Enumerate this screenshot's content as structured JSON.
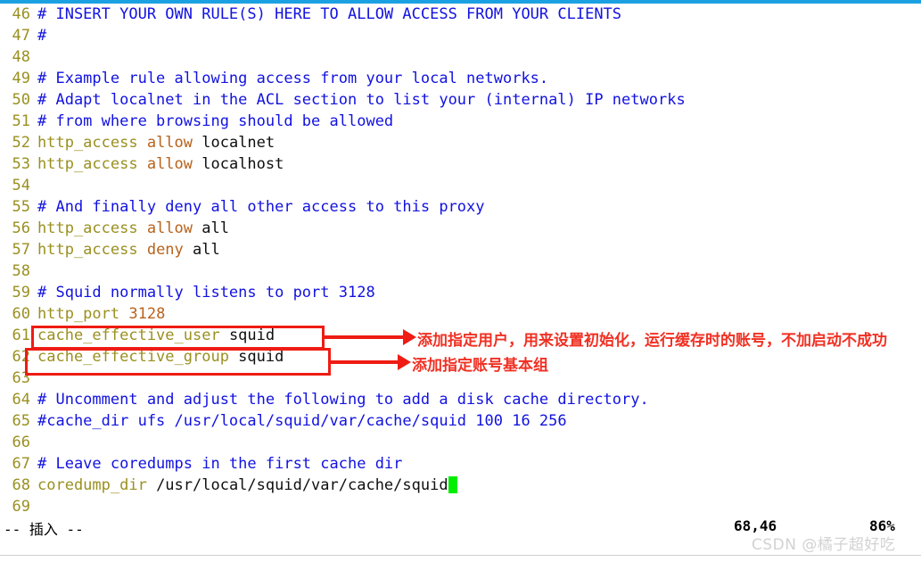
{
  "editor": {
    "app": "vim",
    "status": {
      "mode_label": "-- 插入 --",
      "position": "68,46",
      "percent": "86%"
    },
    "watermark": "CSDN @橘子超好吃",
    "lines": [
      {
        "num": "46",
        "tokens": [
          {
            "t": "# INSERT YOUR OWN RULE(S) HERE TO ALLOW ACCESS FROM YOUR CLIENTS",
            "c": "tok-comment"
          }
        ]
      },
      {
        "num": "47",
        "tokens": [
          {
            "t": "#",
            "c": "tok-comment"
          }
        ]
      },
      {
        "num": "48",
        "tokens": [
          {
            "t": "",
            "c": "tok-value"
          }
        ]
      },
      {
        "num": "49",
        "tokens": [
          {
            "t": "# Example rule allowing access from your local networks.",
            "c": "tok-comment"
          }
        ]
      },
      {
        "num": "50",
        "tokens": [
          {
            "t": "# Adapt localnet in the ACL section to list your (internal) IP networks",
            "c": "tok-comment"
          }
        ]
      },
      {
        "num": "51",
        "tokens": [
          {
            "t": "# from where browsing should be allowed",
            "c": "tok-comment"
          }
        ]
      },
      {
        "num": "52",
        "tokens": [
          {
            "t": "http_access ",
            "c": "tok-keyword"
          },
          {
            "t": "allow ",
            "c": "tok-action"
          },
          {
            "t": "localnet",
            "c": "tok-value"
          }
        ]
      },
      {
        "num": "53",
        "tokens": [
          {
            "t": "http_access ",
            "c": "tok-keyword"
          },
          {
            "t": "allow ",
            "c": "tok-action"
          },
          {
            "t": "localhost",
            "c": "tok-value"
          }
        ]
      },
      {
        "num": "54",
        "tokens": [
          {
            "t": "",
            "c": "tok-value"
          }
        ]
      },
      {
        "num": "55",
        "tokens": [
          {
            "t": "# And finally deny all other access to this proxy",
            "c": "tok-comment"
          }
        ]
      },
      {
        "num": "56",
        "tokens": [
          {
            "t": "http_access ",
            "c": "tok-keyword"
          },
          {
            "t": "allow ",
            "c": "tok-action"
          },
          {
            "t": "all",
            "c": "tok-value"
          }
        ]
      },
      {
        "num": "57",
        "tokens": [
          {
            "t": "http_access ",
            "c": "tok-keyword"
          },
          {
            "t": "deny ",
            "c": "tok-action"
          },
          {
            "t": "all",
            "c": "tok-value"
          }
        ]
      },
      {
        "num": "58",
        "tokens": [
          {
            "t": "",
            "c": "tok-value"
          }
        ]
      },
      {
        "num": "59",
        "tokens": [
          {
            "t": "# Squid normally listens to port 3128",
            "c": "tok-comment"
          }
        ]
      },
      {
        "num": "60",
        "tokens": [
          {
            "t": "http_port ",
            "c": "tok-keyword"
          },
          {
            "t": "3128",
            "c": "tok-number"
          }
        ]
      },
      {
        "num": "61",
        "tokens": [
          {
            "t": "cache_effective_user ",
            "c": "tok-keyword"
          },
          {
            "t": "squid",
            "c": "tok-value"
          }
        ]
      },
      {
        "num": "62",
        "tokens": [
          {
            "t": "cache_effective_group ",
            "c": "tok-keyword"
          },
          {
            "t": "squid",
            "c": "tok-value"
          }
        ]
      },
      {
        "num": "63",
        "tokens": [
          {
            "t": "",
            "c": "tok-value"
          }
        ]
      },
      {
        "num": "64",
        "tokens": [
          {
            "t": "# Uncomment and adjust the following to add a disk cache directory.",
            "c": "tok-comment"
          }
        ]
      },
      {
        "num": "65",
        "tokens": [
          {
            "t": "#cache_dir ufs /usr/local/squid/var/cache/squid 100 16 256",
            "c": "tok-comment"
          }
        ]
      },
      {
        "num": "66",
        "tokens": [
          {
            "t": "",
            "c": "tok-value"
          }
        ]
      },
      {
        "num": "67",
        "tokens": [
          {
            "t": "# Leave coredumps in the first cache dir",
            "c": "tok-comment"
          }
        ]
      },
      {
        "num": "68",
        "tokens": [
          {
            "t": "coredump_dir ",
            "c": "tok-keyword"
          },
          {
            "t": "/usr/local/squid/var/cache/squid",
            "c": "tok-path"
          }
        ],
        "cursor": true
      },
      {
        "num": "69",
        "tokens": [
          {
            "t": "",
            "c": "tok-value"
          }
        ]
      }
    ]
  },
  "annotations": {
    "color": "#ee1c14",
    "items": [
      {
        "text": "添加指定用户，用来设置初始化，运行缓存时的账号，不加启动不成功",
        "target_line": "61"
      },
      {
        "text": "添加指定账号基本组",
        "target_line": "62"
      }
    ]
  }
}
